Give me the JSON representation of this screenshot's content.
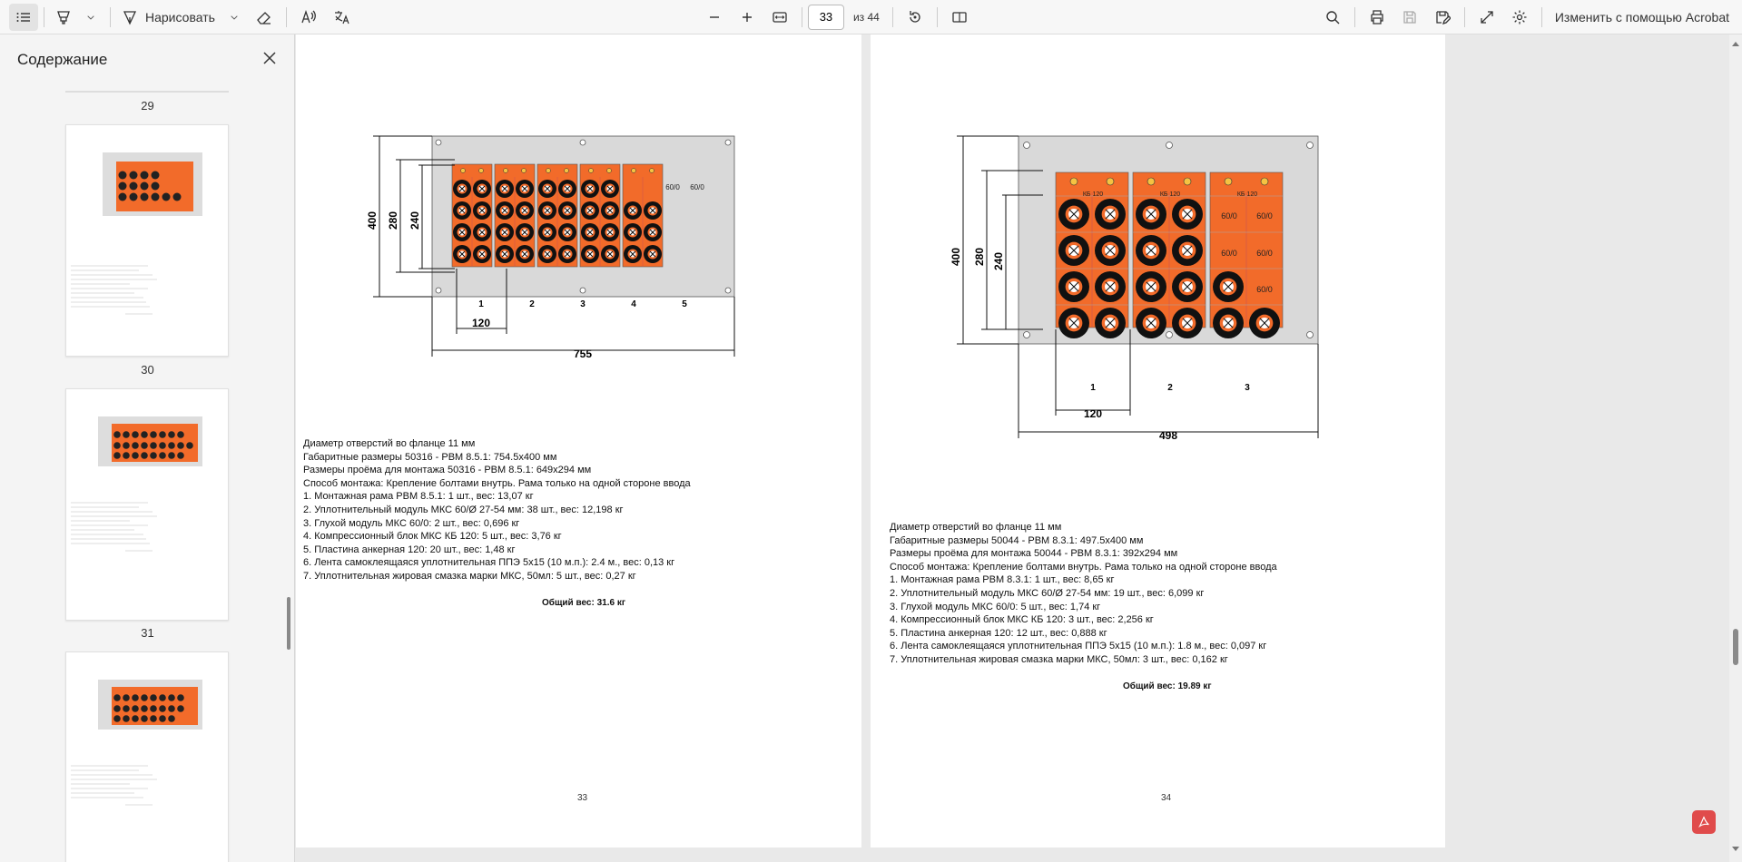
{
  "toolbar": {
    "draw_label": "Нарисовать",
    "page_current": "33",
    "page_of": "из 44",
    "edit_acrobat": "Изменить с помощью Acrobat"
  },
  "sidebar": {
    "title": "Содержание",
    "thumb_labels": [
      "29",
      "30",
      "31"
    ]
  },
  "page33": {
    "dims": {
      "height_total": "400",
      "height_inner": "280",
      "height_hole": "240",
      "col_width": "120",
      "total_width": "755"
    },
    "columns": [
      "1",
      "2",
      "3",
      "4",
      "5"
    ],
    "blind_label": "60/0",
    "lines": [
      "Диаметр отверстий во фланце 11 мм",
      "Габаритные размеры 50316 - PBM 8.5.1: 754.5x400 мм",
      "Размеры проёма для монтажа 50316 - PBM 8.5.1: 649x294 мм",
      "Способ монтажа: Крепление болтами внутрь. Рама только на одной стороне ввода",
      "1. Монтажная рама PBM 8.5.1: 1 шт., вес: 13,07 кг",
      "2. Уплотнительный модуль МКС 60/Ø 27-54 мм: 38 шт., вес: 12,198 кг",
      "3. Глухой модуль МКС 60/0: 2 шт., вес: 0,696 кг",
      "4. Компрессионный блок МКС КБ 120: 5 шт., вес: 3,76 кг",
      "5. Пластина анкерная 120: 20 шт., вес: 1,48 кг",
      "6. Лента самоклеящаяся уплотнительная ППЭ 5x15 (10 м.п.): 2.4 м., вес: 0,13 кг",
      "7. Уплотнительная жировая смазка марки МКС, 50мл: 5 шт., вес: 0,27 кг"
    ],
    "total": "Общий вес: 31.6 кг",
    "page_number": "33"
  },
  "page34": {
    "dims": {
      "height_total": "400",
      "height_inner": "280",
      "height_hole": "240",
      "col_width": "120",
      "total_width": "498"
    },
    "columns": [
      "1",
      "2",
      "3"
    ],
    "kb_label": "КБ 120",
    "blind_label": "60/0",
    "lines": [
      "Диаметр отверстий во фланце 11 мм",
      "Габаритные размеры 50044 - PBM 8.3.1: 497.5x400 мм",
      "Размеры проёма для монтажа 50044 - PBM 8.3.1: 392x294 мм",
      "Способ монтажа: Крепление болтами внутрь. Рама только на одной стороне ввода",
      "1. Монтажная рама PBM 8.3.1: 1 шт., вес: 8,65 кг",
      "2. Уплотнительный модуль МКС 60/Ø 27-54 мм: 19 шт., вес: 6,099 кг",
      "3. Глухой модуль МКС 60/0: 5 шт., вес: 1,74 кг",
      "4. Компрессионный блок МКС КБ 120: 3 шт., вес: 2,256 кг",
      "5. Пластина анкерная 120: 12 шт., вес: 0,888 кг",
      "6. Лента самоклеящаяся уплотнительная ППЭ 5x15 (10 м.п.): 1.8 м., вес: 0,097 кг",
      "7. Уплотнительная жировая смазка марки МКС, 50мл: 3 шт., вес: 0,162 кг"
    ],
    "total": "Общий вес: 19.89 кг",
    "page_number": "34"
  },
  "colors": {
    "accent": "#f26b2a",
    "frame": "#d9d9d9",
    "toolbar": "#f7f7f7",
    "acrobat_red": "#e04b4b"
  }
}
